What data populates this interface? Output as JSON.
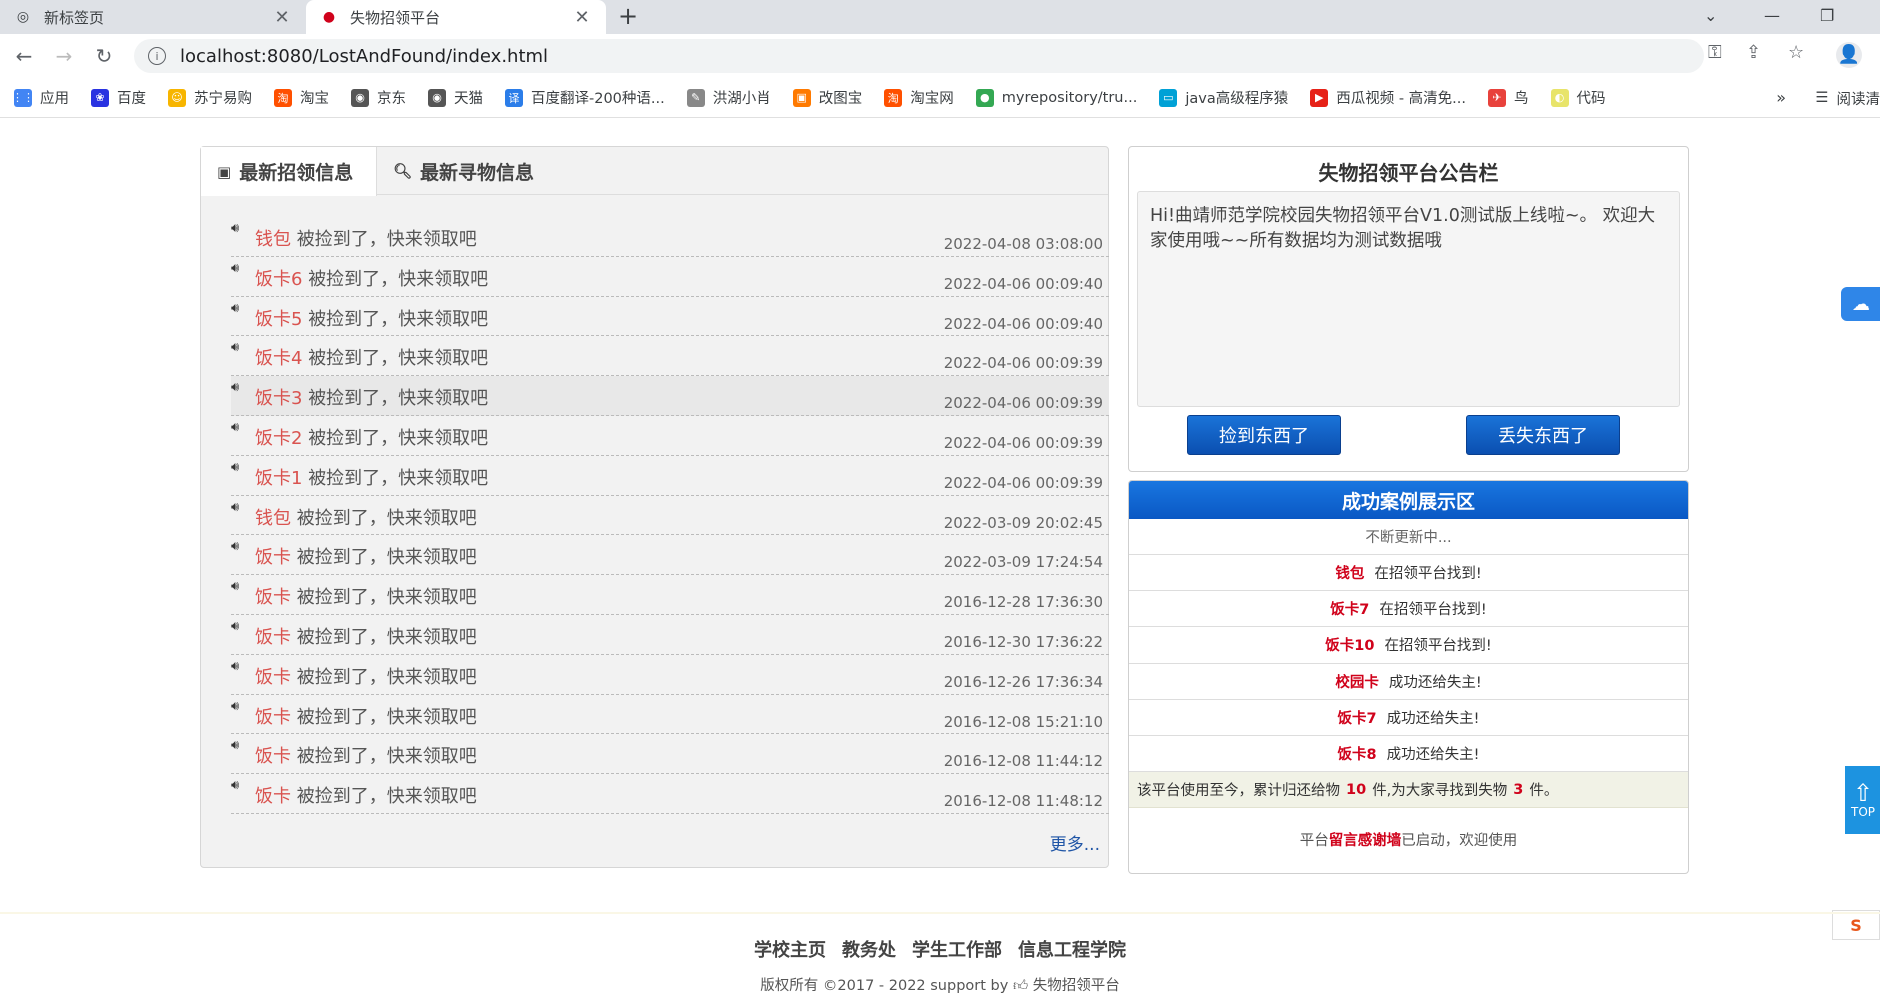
{
  "browser": {
    "tabs": [
      {
        "title": "新标签页"
      },
      {
        "title": "失物招领平台"
      }
    ],
    "url": "localhost:8080/LostAndFound/index.html",
    "bookmarks": [
      {
        "label": "应用",
        "color": "#4285f4",
        "glyph": "⋮⋮"
      },
      {
        "label": "百度",
        "color": "#2932e1",
        "glyph": "❀"
      },
      {
        "label": "苏宁易购",
        "color": "#f7b500",
        "glyph": "☺"
      },
      {
        "label": "淘宝",
        "color": "#ff5000",
        "glyph": "淘"
      },
      {
        "label": "京东",
        "color": "#555555",
        "glyph": "◉"
      },
      {
        "label": "天猫",
        "color": "#555555",
        "glyph": "◉"
      },
      {
        "label": "百度翻译-200种语...",
        "color": "#2b7de9",
        "glyph": "译"
      },
      {
        "label": "洪湖小肖",
        "color": "#888888",
        "glyph": "✎"
      },
      {
        "label": "改图宝",
        "color": "#ff7a00",
        "glyph": "▣"
      },
      {
        "label": "淘宝网",
        "color": "#ff5000",
        "glyph": "淘"
      },
      {
        "label": "myrepository/tru...",
        "color": "#34a853",
        "glyph": "●"
      },
      {
        "label": "java高级程序猿",
        "color": "#00a1d6",
        "glyph": "▭"
      },
      {
        "label": "西瓜视频 - 高清免...",
        "color": "#e62117",
        "glyph": "▶"
      },
      {
        "label": "鸟",
        "color": "#e8423c",
        "glyph": "✈"
      },
      {
        "label": "代码",
        "color": "#e8e46a",
        "glyph": "◐"
      }
    ],
    "reading_list": "阅读清"
  },
  "page": {
    "tabs": {
      "found": "最新招领信息",
      "lost": "最新寻物信息"
    },
    "suffix": "被捡到了，快来领取吧",
    "items": [
      {
        "name": "钱包",
        "date": "2022-04-08 03:08:00"
      },
      {
        "name": "饭卡6",
        "date": "2022-04-06 00:09:40"
      },
      {
        "name": "饭卡5",
        "date": "2022-04-06 00:09:40"
      },
      {
        "name": "饭卡4",
        "date": "2022-04-06 00:09:39"
      },
      {
        "name": "饭卡3",
        "date": "2022-04-06 00:09:39"
      },
      {
        "name": "饭卡2",
        "date": "2022-04-06 00:09:39"
      },
      {
        "name": "饭卡1",
        "date": "2022-04-06 00:09:39"
      },
      {
        "name": "钱包",
        "date": "2022-03-09 20:02:45"
      },
      {
        "name": "饭卡",
        "date": "2022-03-09 17:24:54"
      },
      {
        "name": "饭卡",
        "date": "2016-12-28 17:36:30"
      },
      {
        "name": "饭卡",
        "date": "2016-12-30 17:36:22"
      },
      {
        "name": "饭卡",
        "date": "2016-12-26 17:36:34"
      },
      {
        "name": "饭卡",
        "date": "2016-12-08 15:21:10"
      },
      {
        "name": "饭卡",
        "date": "2016-12-08 11:44:12"
      },
      {
        "name": "饭卡",
        "date": "2016-12-08 11:48:12"
      }
    ],
    "more": "更多...",
    "notice": {
      "title": "失物招领平台公告栏",
      "text": "Hi!曲靖师范学院校园失物招领平台V1.0测试版上线啦~。 欢迎大家使用哦~~所有数据均为测试数据哦",
      "found_button": "捡到东西了",
      "lost_button": "丢失东西了"
    },
    "cases": {
      "title": "成功案例展示区",
      "subtitle": "不断更新中...",
      "list": [
        {
          "name": "钱包",
          "text": "在招领平台找到!"
        },
        {
          "name": "饭卡7",
          "text": "在招领平台找到!"
        },
        {
          "name": "饭卡10",
          "text": "在招领平台找到!"
        },
        {
          "name": "校园卡",
          "text": "成功还给失主!"
        },
        {
          "name": "饭卡7",
          "text": "成功还给失主!"
        },
        {
          "name": "饭卡8",
          "text": "成功还给失主!"
        }
      ],
      "stat_prefix": "该平台使用至今，累计归还给物",
      "stat_returned": "10",
      "stat_mid": "件,为大家寻找到失物",
      "stat_found": "3",
      "stat_suffix": "件。",
      "wall_prefix": "平台",
      "wall_link": "留言感谢墙",
      "wall_suffix": "已启动，欢迎使用"
    },
    "top_label": "TOP",
    "footer": {
      "links": [
        "学校主页",
        "教务处",
        "学生工作部",
        "信息工程学院"
      ],
      "copyright": "版权所有 ©2017 - 2022 support by",
      "brand": "失物招领平台"
    }
  }
}
